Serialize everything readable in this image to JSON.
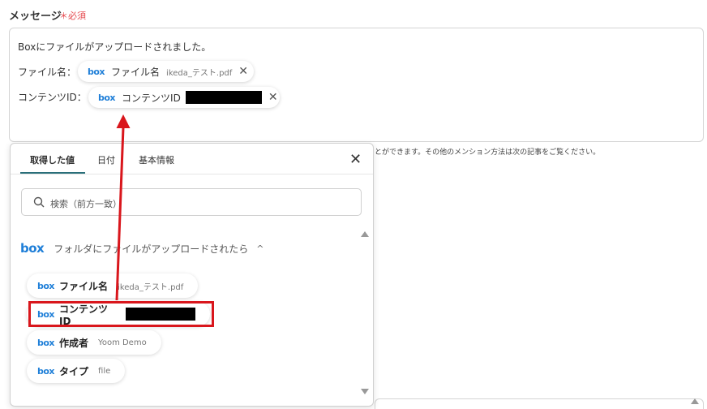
{
  "field": {
    "label": "メッセージ",
    "required": "＊必須"
  },
  "editor": {
    "line1": "Boxにファイルがアップロードされました。",
    "file_label": "ファイル名：",
    "content_label": "コンテンツID：",
    "chip_file": {
      "logo": "box",
      "name": "ファイル名",
      "value": "ikeda_テスト.pdf",
      "close": "✕"
    },
    "chip_content": {
      "logo": "box",
      "name": "コンテンツID",
      "close": "✕"
    }
  },
  "hint_text": "とができます。その他のメンション方法は次の記事をご覧ください。",
  "popup": {
    "tabs": [
      "取得した値",
      "日付",
      "基本情報"
    ],
    "active_tab": "取得した値",
    "close": "✕",
    "search_placeholder": "検索（前方一致）",
    "group": {
      "logo": "box",
      "title": "フォルダにファイルがアップロードされたら",
      "chevron": "^"
    },
    "items": [
      {
        "logo": "box",
        "name": "ファイル名",
        "value": "ikeda_テスト.pdf"
      },
      {
        "logo": "box",
        "name": "コンテンツID",
        "value": ""
      },
      {
        "logo": "box",
        "name": "作成者",
        "value": "Yoom Demo"
      },
      {
        "logo": "box",
        "name": "タイプ",
        "value": "file"
      }
    ]
  },
  "colors": {
    "box_blue": "#1f7fd8",
    "required_red": "#e5484d",
    "annotation_red": "#d9161c",
    "tab_underline": "#2a6f7a"
  },
  "icons": {
    "search": "search-icon",
    "close": "close-icon",
    "chevron": "chevron-up-icon"
  }
}
